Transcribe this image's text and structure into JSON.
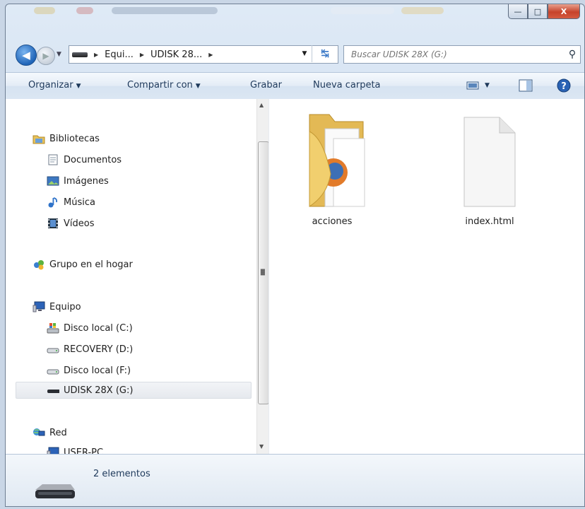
{
  "window": {
    "controls": {
      "minimize": "—",
      "maximize": "□",
      "close": "X"
    }
  },
  "address": {
    "segments": [
      "Equi...",
      "UDISK 28..."
    ],
    "search_placeholder": "Buscar UDISK 28X (G:)"
  },
  "toolbar": {
    "organize": "Organizar",
    "share": "Compartir con",
    "burn": "Grabar",
    "new_folder": "Nueva carpeta"
  },
  "nav": {
    "libraries": "Bibliotecas",
    "documents": "Documentos",
    "images": "Imágenes",
    "music": "Música",
    "videos": "Vídeos",
    "homegroup": "Grupo en el hogar",
    "computer": "Equipo",
    "drive_c": "Disco local (C:)",
    "drive_d": "RECOVERY (D:)",
    "drive_f": "Disco local (F:)",
    "drive_g": "UDISK 28X (G:)",
    "network": "Red",
    "user_pc": "USER-PC"
  },
  "files": [
    {
      "name": "acciones",
      "type": "folder"
    },
    {
      "name": "index.html",
      "type": "file"
    }
  ],
  "status": {
    "count": "2 elementos"
  },
  "colors": {
    "accent": "#1f64b8",
    "close": "#c6432b",
    "toolbar_text": "#1e395b"
  }
}
